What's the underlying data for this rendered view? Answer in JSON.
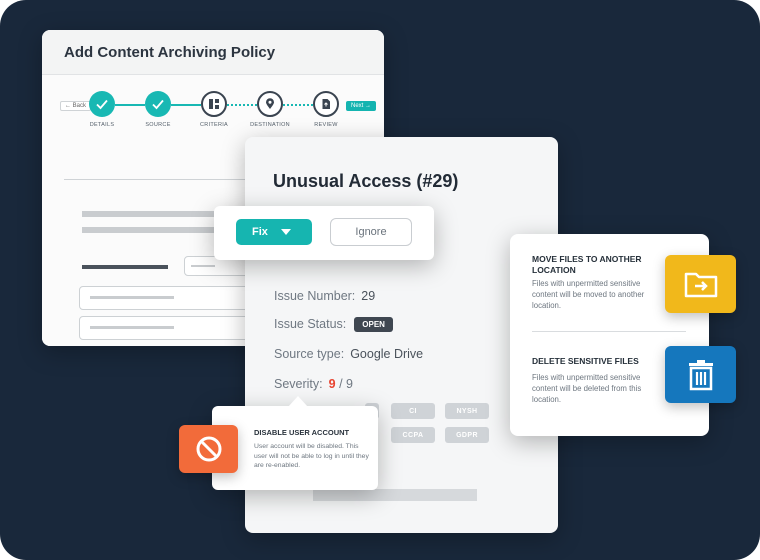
{
  "policy": {
    "title": "Add Content Archiving Policy",
    "back_label": "← Back",
    "next_label": "Next →",
    "steps": [
      {
        "label": "DETAILS",
        "state": "done"
      },
      {
        "label": "SOURCE",
        "state": "done"
      },
      {
        "label": "CRITERIA",
        "state": "current"
      },
      {
        "label": "DESTINATION",
        "state": "todo"
      },
      {
        "label": "REVIEW",
        "state": "todo"
      }
    ]
  },
  "issue": {
    "title": "Unusual Access (#29)",
    "number_label": "Issue Number:",
    "number_value": "29",
    "status_label": "Issue Status:",
    "status_value": "OPEN",
    "source_label": "Source type:",
    "source_value": "Google Drive",
    "severity_label": "Severity:",
    "severity_value": "9",
    "severity_max": "/ 9",
    "tags": [
      "CI",
      "NYSH",
      "CCPA",
      "GDPR"
    ]
  },
  "action_popup": {
    "fix_label": "Fix",
    "ignore_label": "Ignore"
  },
  "disable_popup": {
    "title": "DISABLE USER ACCOUNT",
    "description": "User account will be disabled. This user will not be able to log in until they are re-enabled."
  },
  "file_actions": {
    "move_title": "MOVE FILES TO ANOTHER LOCATION",
    "move_desc": "Files with unpermitted sensitive content will be moved to another location.",
    "delete_title": "DELETE SENSITIVE FILES",
    "delete_desc": "Files with unpermitted sensitive content will be deleted from this location."
  },
  "icons": {
    "step_done": "check-icon",
    "step_criteria": "grid-icon",
    "step_destination": "location-pin-icon",
    "step_review": "document-icon",
    "fix_dropdown": "caret-down-icon",
    "disable": "ban-icon",
    "move": "folder-move-icon",
    "delete": "trash-icon"
  },
  "colors": {
    "background": "#19283b",
    "accent_teal": "#16b5b0",
    "severity_red": "#e8432f",
    "disable_orange": "#f26b3a",
    "move_yellow": "#f1b81b",
    "delete_blue": "#1577bd"
  }
}
